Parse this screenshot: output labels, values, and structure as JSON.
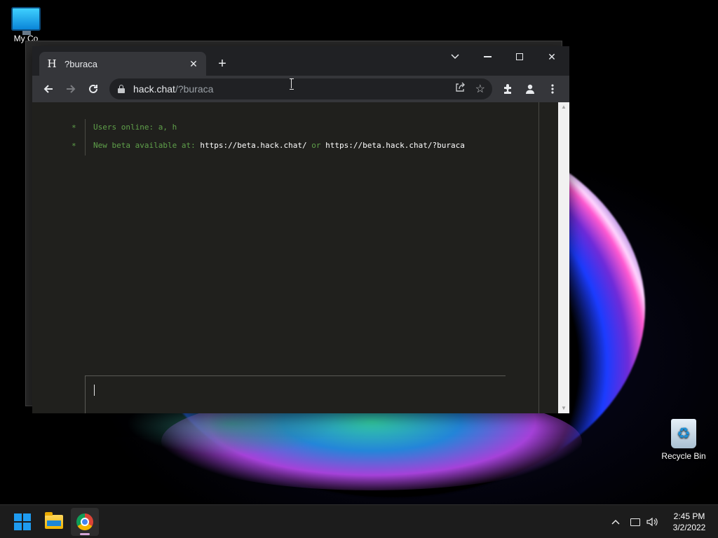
{
  "desktop": {
    "icons": [
      {
        "label": "My Co"
      },
      {
        "label": "Recycle Bin"
      }
    ]
  },
  "browser": {
    "tab": {
      "favicon_letter": "H",
      "title": "?buraca"
    },
    "omnibox": {
      "host": "hack.chat",
      "path": "/?buraca"
    }
  },
  "chat": {
    "messages": [
      {
        "star": "*",
        "text": "Users online: a, h"
      },
      {
        "star": "*",
        "prefix": "New beta available at: ",
        "link1": "https://beta.hack.chat/",
        "middle": " or ",
        "link2": "https://beta.hack.chat/?buraca"
      }
    ],
    "input_value": ""
  },
  "taskbar": {
    "time": "2:45 PM",
    "date": "3/2/2022"
  },
  "colors": {
    "chat_green": "#5fa04a",
    "chat_bg": "#20201d",
    "browser_frame": "#202124",
    "toolbar": "#35363a"
  }
}
